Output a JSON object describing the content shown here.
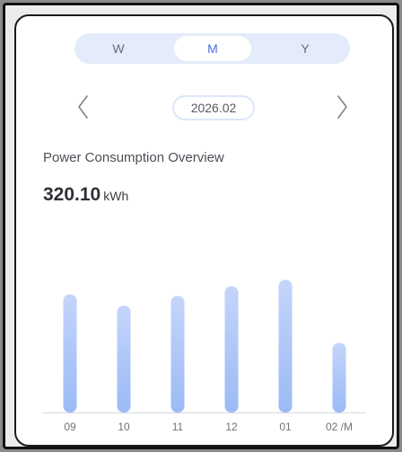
{
  "toggle": {
    "items": [
      "W",
      "M",
      "Y"
    ],
    "selected": "M"
  },
  "date_nav": {
    "current": "2026.02",
    "prev_icon": "chevron-left-icon",
    "next_icon": "chevron-right-icon"
  },
  "overview": {
    "title": "Power Consumption Overview",
    "total_value": "320.10",
    "total_unit": "kWh"
  },
  "colors": {
    "accent": "#4a6fdc",
    "toggle_bg": "#e4ecfb",
    "bar_top": "#c4d5fb",
    "bar_bottom": "#9bbaf5"
  },
  "chart_data": {
    "type": "bar",
    "categories": [
      "09",
      "10",
      "11",
      "12",
      "01",
      "02 /M"
    ],
    "values": [
      73,
      66,
      72,
      78,
      82,
      43
    ],
    "ylim": [
      0,
      100
    ],
    "grid": false,
    "title": "",
    "xlabel": "",
    "ylabel": ""
  }
}
